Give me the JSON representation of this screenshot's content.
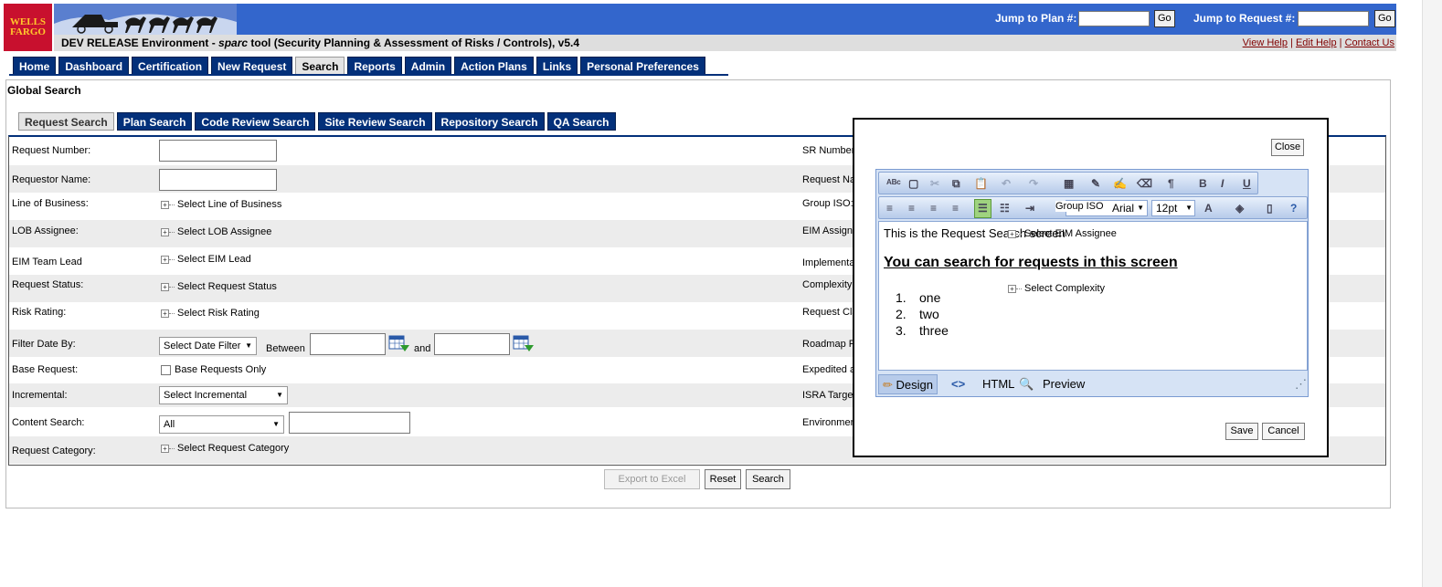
{
  "brand": {
    "logo_line1": "WELLS",
    "logo_line2": "FARGO"
  },
  "header": {
    "jump_plan_label": "Jump to Plan #:",
    "jump_plan_value": "",
    "jump_request_label": "Jump to Request #:",
    "jump_request_value": "",
    "go_label": "Go"
  },
  "subheader": {
    "env_prefix": "DEV RELEASE Environment - ",
    "env_tool": "sparc",
    "env_suffix": " tool (Security Planning & Assessment of Risks / Controls), v5.4",
    "help_links": [
      "View Help",
      "Edit Help",
      "Contact Us"
    ],
    "separator": "|"
  },
  "main_tabs": [
    "Home",
    "Dashboard",
    "Certification",
    "New Request",
    "Search",
    "Reports",
    "Admin",
    "Action Plans",
    "Links",
    "Personal Preferences"
  ],
  "active_main_tab": "Search",
  "page_title": "Global Search",
  "sub_tabs": [
    "Request Search",
    "Plan Search",
    "Code Review Search",
    "Site Review Search",
    "Repository Search",
    "QA Search"
  ],
  "active_sub_tab": "Request Search",
  "form": {
    "request_number_label": "Request Number:",
    "requestor_name_label": "Requestor Name:",
    "line_of_business_label": "Line of Business:",
    "line_of_business_tree": "Select Line of Business",
    "lob_assignee_label": "LOB Assignee:",
    "lob_assignee_tree": "Select LOB Assignee",
    "eim_team_lead_label": "EIM Team Lead",
    "eim_lead_tree": "Select EIM Lead",
    "request_status_label": "Request Status:",
    "request_status_tree": "Select Request Status",
    "risk_rating_label": "Risk Rating:",
    "risk_rating_tree": "Select Risk Rating",
    "filter_date_label": "Filter Date By:",
    "filter_date_select": "Select Date Filter",
    "between_label": "Between",
    "and_label": "and",
    "base_request_label": "Base Request:",
    "base_requests_only": "Base Requests Only",
    "incremental_label": "Incremental:",
    "incremental_select": "Select Incremental",
    "content_search_label": "Content Search:",
    "content_search_select": "All",
    "request_category_label": "Request Category:",
    "request_category_tree": "Select Request Category"
  },
  "right_labels": [
    "SR Number",
    "Request Na",
    "Group ISO:",
    "EIM Assigne",
    "Implementati",
    "Complexity:",
    "Request Cla",
    "Roadmap F",
    "Expedited a",
    "ISRA Targe",
    "Environmen"
  ],
  "buttons": {
    "export": "Export to Excel",
    "reset": "Reset",
    "search": "Search"
  },
  "modal": {
    "close_label": "Close",
    "font_name": "Arial",
    "font_size": "12pt",
    "content_paragraph": "This is the Request Search screen",
    "content_heading": "You can search for requests in this screen",
    "content_list": [
      "one",
      "two",
      "three"
    ],
    "mode_design": "Design",
    "mode_html": "HTML",
    "mode_preview": "Preview",
    "save_label": "Save",
    "cancel_label": "Cancel",
    "overlap_group_iso": "Group ISO",
    "overlap_select_eim_assignee": "Select EIM Assignee",
    "overlap_select_complexity": "Select Complexity"
  },
  "colors": {
    "header_blue": "#3366cc",
    "tab_navy": "#03307a",
    "brand_red": "#c8102e",
    "brand_gold": "#ffc72c",
    "help_link": "#800000"
  }
}
